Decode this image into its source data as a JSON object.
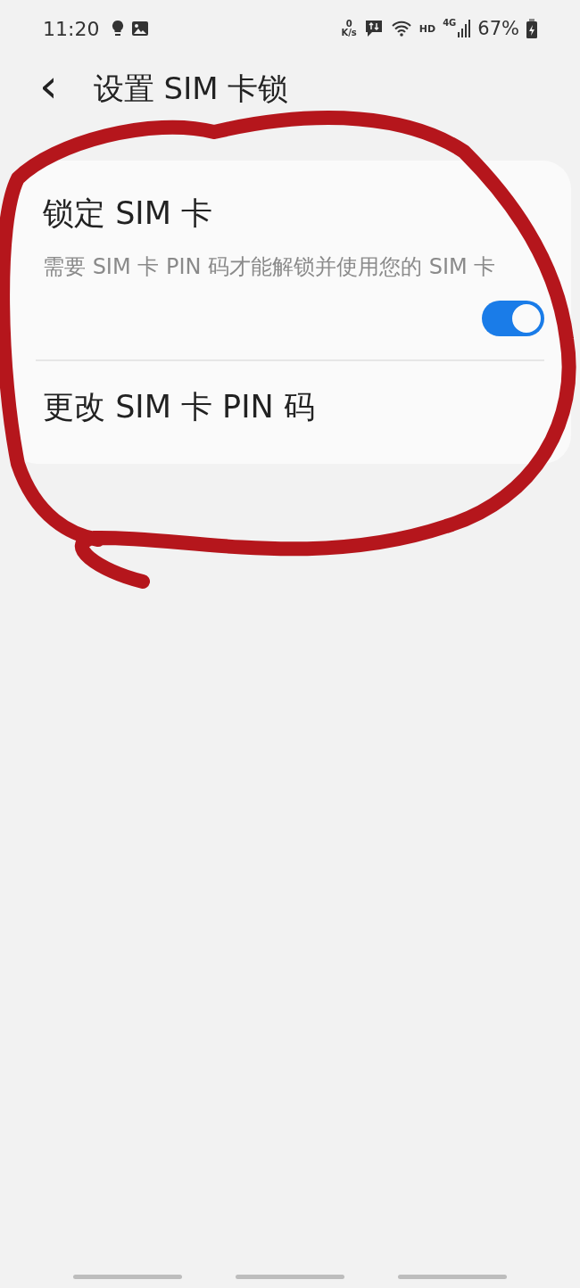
{
  "status_bar": {
    "time": "11:20",
    "net_speed_value": "0",
    "net_speed_unit": "K/s",
    "hd": "HD",
    "network": "4G",
    "battery": "67%"
  },
  "header": {
    "back": "‹",
    "title": "设置 SIM 卡锁"
  },
  "items": [
    {
      "kind": "switch",
      "title": "锁定 SIM 卡",
      "description": "需要 SIM 卡 PIN 码才能解锁并使用您的 SIM 卡",
      "on": true
    },
    {
      "kind": "link",
      "title": "更改 SIM 卡 PIN 码"
    }
  ]
}
